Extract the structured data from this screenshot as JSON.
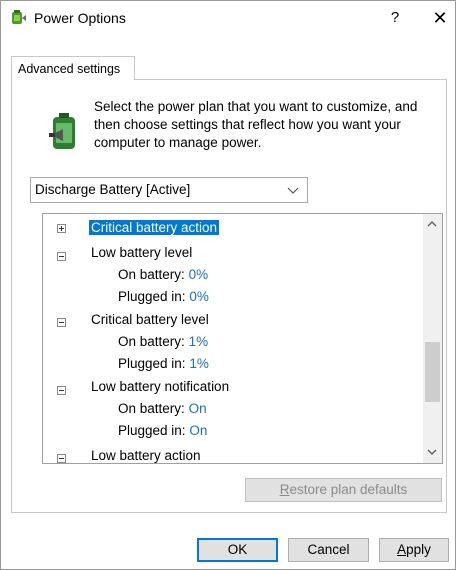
{
  "window": {
    "title": "Power Options",
    "help_glyph": "?",
    "close_glyph": "✕"
  },
  "tab": {
    "label": "Advanced settings"
  },
  "intro": {
    "text": "Select the power plan that you want to customize, and then choose settings that reflect how you want your computer to manage power."
  },
  "plan_select": {
    "value": "Discharge Battery [Active]"
  },
  "tree": {
    "items": [
      {
        "label": "Critical battery action",
        "expanded": false,
        "selected": true
      },
      {
        "label": "Low battery level",
        "expanded": true,
        "children": [
          {
            "label": "On battery:",
            "value": "0%"
          },
          {
            "label": "Plugged in:",
            "value": "0%"
          }
        ]
      },
      {
        "label": "Critical battery level",
        "expanded": true,
        "children": [
          {
            "label": "On battery:",
            "value": "1%"
          },
          {
            "label": "Plugged in:",
            "value": "1%"
          }
        ]
      },
      {
        "label": "Low battery notification",
        "expanded": true,
        "children": [
          {
            "label": "On battery:",
            "value": "On"
          },
          {
            "label": "Plugged in:",
            "value": "On"
          }
        ]
      },
      {
        "label": "Low battery action",
        "expanded": true
      }
    ]
  },
  "buttons": {
    "restore": {
      "prefix": "R",
      "rest": "estore plan defaults"
    },
    "ok": "OK",
    "cancel": "Cancel",
    "apply": {
      "prefix": "A",
      "rest": "pply"
    }
  },
  "colors": {
    "selection": "#0078d7",
    "value_text": "#1a6fbf",
    "disabled_text": "#8c8c8c"
  }
}
